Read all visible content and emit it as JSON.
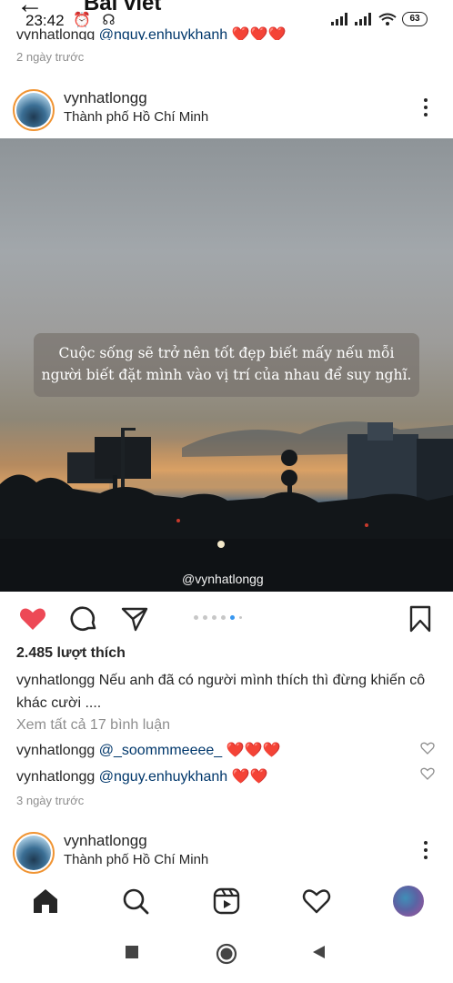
{
  "header": {
    "title": "Bài viết"
  },
  "status_bar": {
    "time": "23:42",
    "battery": "63"
  },
  "previous_post": {
    "comment_user": "vynhatlongg",
    "comment_mention": "@nguy.enhuykhanh",
    "comment_hearts": "❤️❤️❤️",
    "time": "2 ngày trước"
  },
  "post": {
    "username": "vynhatlongg",
    "location": "Thành phố Hồ Chí Minh",
    "quote": "Cuộc sống sẽ trở nên tốt đẹp biết mấy nếu mỗi người biết đặt mình vào vị trí của nhau để suy nghĩ.",
    "watermark": "@vynhatlongg",
    "carousel": {
      "count": 6,
      "active_index": 4
    },
    "likes": "2.485 lượt thích",
    "caption_user": "vynhatlongg",
    "caption_text": "Nếu anh đã có người mình thích thì đừng khiến cô khác cười ....",
    "view_all_comments": "Xem tất cả 17 bình luận",
    "comments": [
      {
        "user": "vynhatlongg",
        "mention": "@_soommmeeee_",
        "hearts": "❤️❤️❤️"
      },
      {
        "user": "vynhatlongg",
        "mention": "@nguy.enhuykhanh",
        "hearts": "❤️❤️"
      }
    ],
    "time": "3 ngày trước",
    "liked": true
  },
  "next_post": {
    "username": "vynhatlongg",
    "location": "Thành phố Hồ Chí Minh"
  },
  "icons": {
    "like": "heart-filled-icon",
    "comment": "comment-icon",
    "share": "send-icon",
    "save": "bookmark-icon",
    "more": "more-vertical-icon",
    "nav": [
      "home-icon",
      "search-icon",
      "reels-icon",
      "activity-heart-icon",
      "profile-avatar"
    ]
  },
  "colors": {
    "like_red": "#ed4956",
    "mention_blue": "#00376b",
    "carousel_active": "#3897f0"
  }
}
